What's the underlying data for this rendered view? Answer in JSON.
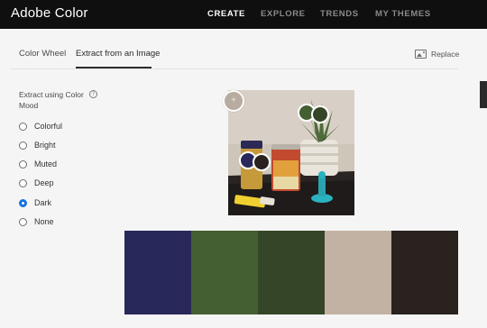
{
  "header": {
    "app_title": "Adobe Color",
    "nav": [
      {
        "label": "CREATE",
        "active": true
      },
      {
        "label": "EXPLORE",
        "active": false
      },
      {
        "label": "TRENDS",
        "active": false
      },
      {
        "label": "MY THEMES",
        "active": false
      }
    ]
  },
  "tabs": [
    {
      "label": "Color Wheel",
      "active": false
    },
    {
      "label": "Extract from an Image",
      "active": true
    }
  ],
  "replace_label": "Replace",
  "extract": {
    "label": "Extract using Color Mood",
    "info_icon": "?",
    "options": [
      {
        "label": "Colorful",
        "checked": false
      },
      {
        "label": "Bright",
        "checked": false
      },
      {
        "label": "Muted",
        "checked": false
      },
      {
        "label": "Deep",
        "checked": false
      },
      {
        "label": "Dark",
        "checked": true
      },
      {
        "label": "None",
        "checked": false
      }
    ]
  },
  "image": {
    "add_handle": "+"
  },
  "palette": [
    {
      "color": "#28285a"
    },
    {
      "color": "#445f32"
    },
    {
      "color": "#354528"
    },
    {
      "color": "#c2b2a3"
    },
    {
      "color": "#29221f"
    }
  ],
  "colors": {
    "accent": "#1473e6",
    "header_bg": "#0f0f0f"
  }
}
